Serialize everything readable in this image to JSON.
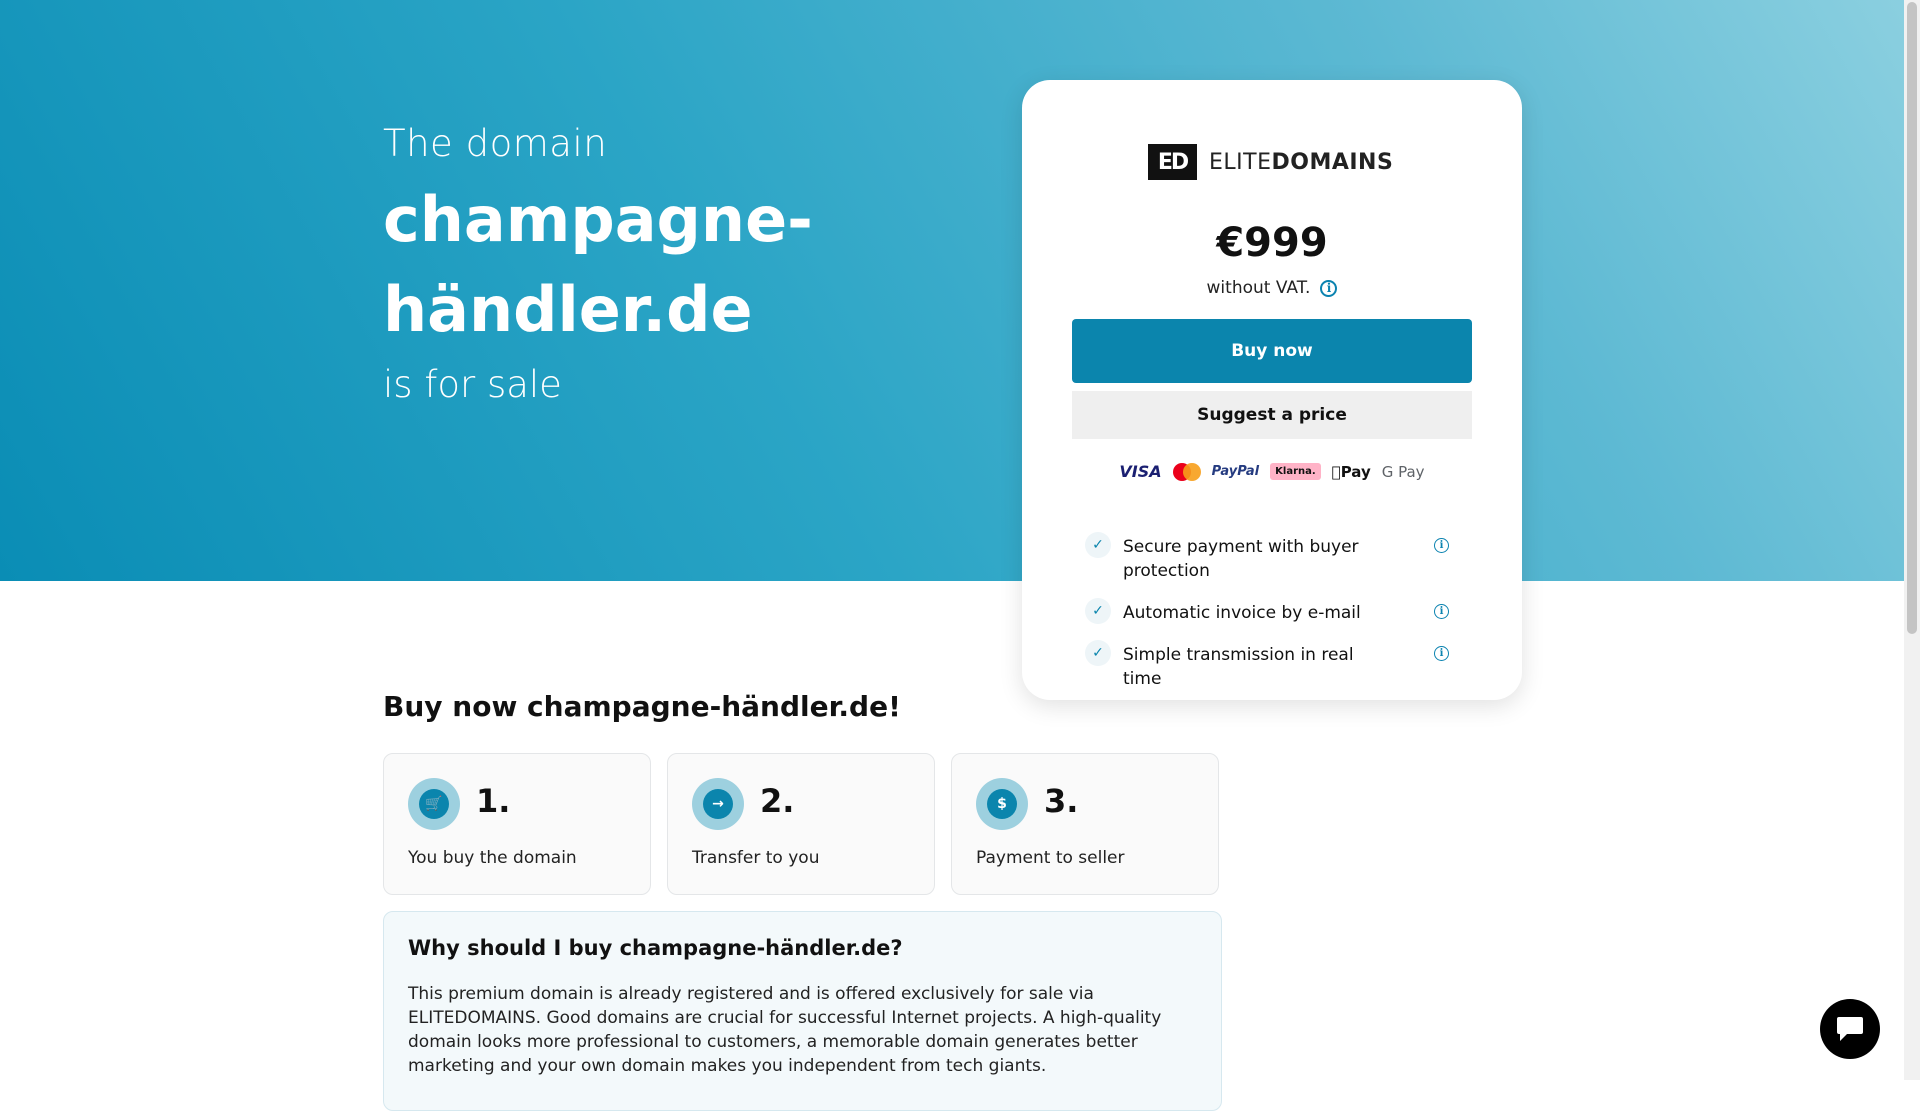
{
  "hero": {
    "prefix": "The domain",
    "domain": "champagne-händler.de",
    "suffix": "is for sale"
  },
  "card": {
    "logo_mark": "ED",
    "logo_text_light": "ELITE",
    "logo_text_bold": "DOMAINS",
    "price": "€999",
    "vat_note": "without VAT.",
    "buy_label": "Buy now",
    "suggest_label": "Suggest a price",
    "payments": {
      "visa": "VISA",
      "paypal": "PayPal",
      "klarna": "Klarna.",
      "apple": "Pay",
      "google": "G Pay"
    },
    "features": [
      {
        "label": "Secure payment with buyer protection"
      },
      {
        "label": "Automatic invoice by e-mail"
      },
      {
        "label": "Simple transmission in real time"
      }
    ]
  },
  "steps_section": {
    "title": "Buy now champagne-händler.de!",
    "steps": [
      {
        "number": "1.",
        "label": "You buy the domain",
        "icon": "cart-icon"
      },
      {
        "number": "2.",
        "label": "Transfer to you",
        "icon": "arrow-right-icon"
      },
      {
        "number": "3.",
        "label": "Payment to seller",
        "icon": "dollar-icon"
      }
    ]
  },
  "why": {
    "title": "Why should I buy champagne-händler.de?",
    "body": "This premium domain is already registered and is offered exclusively for sale via ELITEDOMAINS. Good domains are crucial for successful Internet projects. A high-quality domain looks more professional to customers, a memorable domain generates better marketing and your own domain makes you independent from tech giants."
  },
  "colors": {
    "accent": "#0b85ad",
    "hero_start": "#0a8db5",
    "hero_end": "#8cd0e0"
  }
}
